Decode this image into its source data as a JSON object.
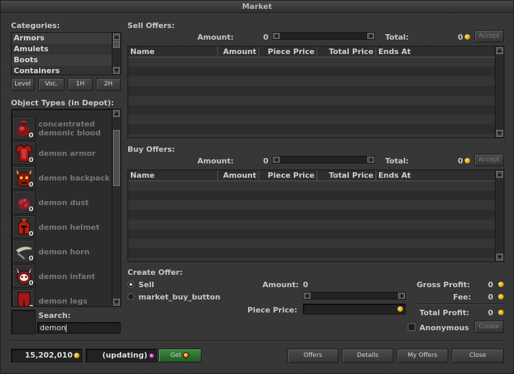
{
  "window": {
    "title": "Market"
  },
  "categories": {
    "label": "Categories:",
    "items": [
      "Armors",
      "Amulets",
      "Boots",
      "Containers"
    ]
  },
  "filters": {
    "level": "Level",
    "vocation": "Voc.",
    "one_hand": "1H",
    "two_hand": "2H"
  },
  "object_types": {
    "label": "Object Types (in Depot):",
    "items": [
      {
        "name": "concentrated demonic blood",
        "count": "0",
        "icon": "blood-flask-icon"
      },
      {
        "name": "demon armor",
        "count": "0",
        "icon": "red-armor-icon"
      },
      {
        "name": "demon backpack",
        "count": "0",
        "icon": "demon-backpack-icon"
      },
      {
        "name": "demon dust",
        "count": "0",
        "icon": "demon-dust-icon"
      },
      {
        "name": "demon helmet",
        "count": "0",
        "icon": "demon-helmet-icon"
      },
      {
        "name": "demon horn",
        "count": "0",
        "icon": "demon-horn-icon"
      },
      {
        "name": "demon infant",
        "count": "0",
        "icon": "demon-infant-icon"
      },
      {
        "name": "demon legs",
        "count": "0",
        "icon": "demon-legs-icon"
      }
    ]
  },
  "search": {
    "label": "Search:",
    "value": "demon"
  },
  "sell_offers": {
    "label": "Sell Offers:",
    "amount_label": "Amount:",
    "amount_value": "0",
    "total_label": "Total:",
    "total_value": "0",
    "accept_label": "Accept",
    "columns": [
      "Name",
      "Amount",
      "Piece Price",
      "Total Price",
      "Ends At"
    ]
  },
  "buy_offers": {
    "label": "Buy Offers:",
    "amount_label": "Amount:",
    "amount_value": "0",
    "total_label": "Total:",
    "total_value": "0",
    "accept_label": "Accept",
    "columns": [
      "Name",
      "Amount",
      "Piece Price",
      "Total Price",
      "Ends At"
    ]
  },
  "create_offer": {
    "label": "Create Offer:",
    "sell_label": "Sell",
    "buy_label": "market_buy_button",
    "amount_label": "Amount:",
    "amount_value": "0",
    "piece_price_label": "Piece Price:",
    "gross_profit_label": "Gross Profit:",
    "gross_profit_value": "0",
    "fee_label": "Fee:",
    "fee_value": "0",
    "total_profit_label": "Total Profit:",
    "total_profit_value": "0",
    "anonymous_label": "Anonymous",
    "create_label": "Create"
  },
  "footer": {
    "gold_balance": "15,202,010",
    "coin_balance": "(updating)",
    "get_label": "Get",
    "offers_label": "Offers",
    "details_label": "Details",
    "my_offers_label": "My Offers",
    "close_label": "Close"
  },
  "colors": {
    "gold_coin": "#e0a000",
    "tibia_coin": "#b030b0",
    "get_button": "#2f6d2f"
  }
}
